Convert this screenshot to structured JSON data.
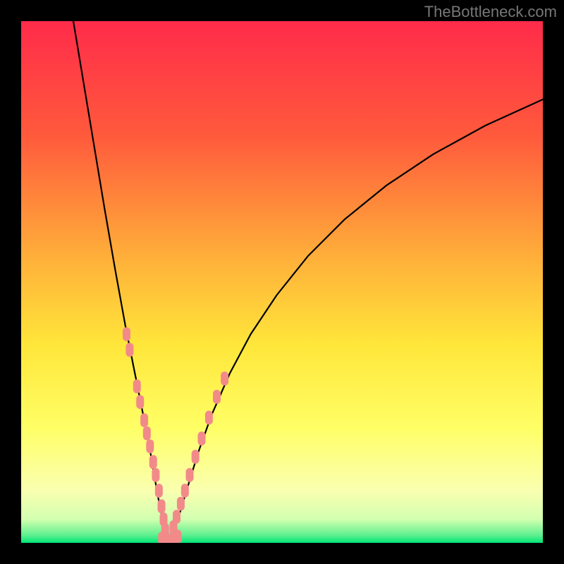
{
  "watermark": "TheBottleneck.com",
  "chart_data": {
    "type": "line",
    "title": "",
    "xlabel": "",
    "ylabel": "",
    "xlim": [
      0,
      100
    ],
    "ylim": [
      0,
      100
    ],
    "gradient_stops": [
      {
        "offset": 0,
        "color": "#ff2b4a"
      },
      {
        "offset": 0.22,
        "color": "#ff5a3c"
      },
      {
        "offset": 0.45,
        "color": "#ffae3a"
      },
      {
        "offset": 0.62,
        "color": "#ffe63a"
      },
      {
        "offset": 0.78,
        "color": "#ffff66"
      },
      {
        "offset": 0.9,
        "color": "#faffb0"
      },
      {
        "offset": 0.955,
        "color": "#d2ffb0"
      },
      {
        "offset": 0.985,
        "color": "#60f090"
      },
      {
        "offset": 1.0,
        "color": "#00e676"
      }
    ],
    "series": [
      {
        "name": "curve-left",
        "x": [
          10.0,
          12.0,
          14.0,
          16.0,
          18.0,
          20.0,
          21.5,
          23.0,
          24.5,
          25.5,
          26.3,
          27.0,
          27.5,
          27.8,
          28.0
        ],
        "y": [
          100.0,
          88.0,
          76.0,
          64.0,
          52.5,
          41.5,
          34.0,
          26.5,
          19.0,
          13.0,
          8.5,
          5.0,
          2.5,
          1.0,
          0.0
        ],
        "color": "#000000",
        "linewidth": 2.2
      },
      {
        "name": "curve-right",
        "x": [
          28.0,
          29.0,
          30.5,
          32.0,
          34.0,
          36.5,
          40.0,
          44.0,
          49.0,
          55.0,
          62.0,
          70.0,
          79.0,
          89.0,
          100.0
        ],
        "y": [
          0.0,
          2.0,
          6.0,
          11.0,
          17.5,
          24.5,
          32.5,
          40.0,
          47.5,
          55.0,
          62.0,
          68.5,
          74.5,
          80.0,
          85.0
        ],
        "color": "#000000",
        "linewidth": 2.2
      },
      {
        "name": "dots-left",
        "type": "scatter",
        "x": [
          20.2,
          20.8,
          22.2,
          22.8,
          23.6,
          24.1,
          24.7,
          25.3,
          25.8,
          26.4,
          26.9,
          27.3,
          27.6
        ],
        "y": [
          40.0,
          37.0,
          30.0,
          27.0,
          23.5,
          21.0,
          18.5,
          15.5,
          13.0,
          10.0,
          7.0,
          4.5,
          2.5
        ],
        "color": "#f28a8a",
        "marker_size": 11
      },
      {
        "name": "dots-right",
        "type": "scatter",
        "x": [
          29.2,
          29.8,
          30.6,
          31.4,
          32.3,
          33.4,
          34.6,
          36.0,
          37.5,
          39.0
        ],
        "y": [
          3.0,
          5.0,
          7.5,
          10.0,
          13.0,
          16.5,
          20.0,
          24.0,
          28.0,
          31.5
        ],
        "color": "#f28a8a",
        "marker_size": 11
      },
      {
        "name": "dots-bottom",
        "type": "scatter",
        "x": [
          27.0,
          27.5,
          28.0,
          28.5,
          29.0,
          29.5,
          30.0
        ],
        "y": [
          0.8,
          0.6,
          0.5,
          0.5,
          0.6,
          0.8,
          1.2
        ],
        "color": "#f28a8a",
        "marker_size": 11
      }
    ]
  }
}
